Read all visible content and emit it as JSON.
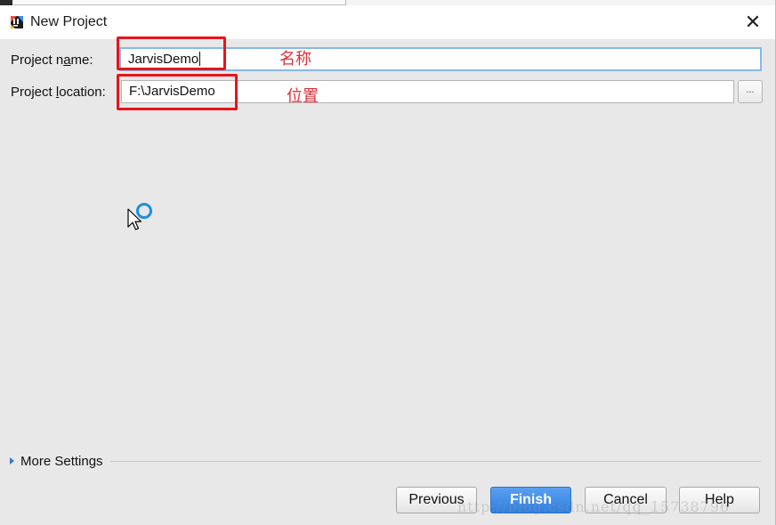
{
  "window": {
    "title": "New Project",
    "close_glyph": "✕"
  },
  "form": {
    "project_name": {
      "label_prefix": "Project n",
      "label_mnemonic": "a",
      "label_suffix": "me:",
      "value": "JarvisDemo"
    },
    "project_location": {
      "label_prefix": "Project ",
      "label_mnemonic": "l",
      "label_suffix": "ocation:",
      "value": "F:\\JarvisDemo",
      "browse_label": "..."
    }
  },
  "annotations": {
    "name_note": "名称",
    "location_note": "位置",
    "box_color": "#e8141a",
    "text_color": "#e0303a"
  },
  "more_settings": {
    "label": "More Settings",
    "mnemonic_index_label": "e"
  },
  "buttons": {
    "previous": "Previous",
    "finish": "Finish",
    "cancel": "Cancel",
    "help": "Help"
  },
  "watermark": "http://blog.csdn.net/qq_15738796",
  "colors": {
    "accent": "#2f7fe0",
    "focus_border": "#86b9e8",
    "busy_indicator": "#1e8ee0"
  },
  "icons": {
    "app": "intellij-idea-icon",
    "close": "close-icon",
    "expand": "triangle-right-icon",
    "cursor": "mouse-pointer-icon",
    "busy": "busy-spinner-icon"
  }
}
